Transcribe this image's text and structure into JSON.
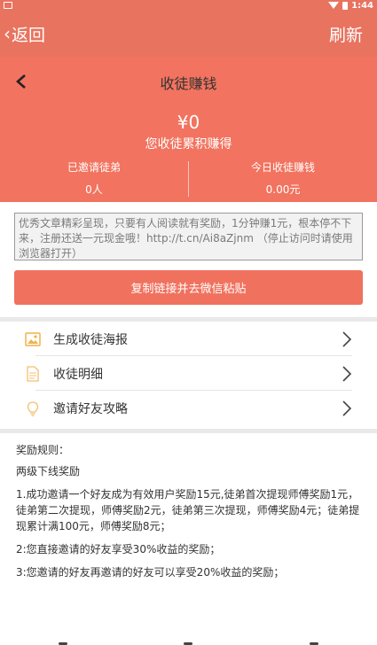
{
  "status_bar": {
    "time": "1:44"
  },
  "app_bar": {
    "back_label": "返回",
    "refresh_label": "刷新"
  },
  "hero": {
    "title": "收徒赚钱",
    "amount": "¥0",
    "amount_caption": "您收徒累积赚得",
    "stats": [
      {
        "label": "已邀请徒弟",
        "value": "0人"
      },
      {
        "label": "今日收徒赚钱",
        "value": "0.00元"
      }
    ]
  },
  "share": {
    "text": "优秀文章精彩呈现，只要有人阅读就有奖励，1分钟赚1元，根本停不下来，注册还送一元现金哦！http://t.cn/Ai8aZjnm （停止访问时请使用浏览器打开）",
    "copy_button": "复制链接并去微信粘贴"
  },
  "menu": [
    {
      "label": "生成收徒海报",
      "icon": "image-icon"
    },
    {
      "label": "收徒明细",
      "icon": "document-icon"
    },
    {
      "label": "邀请好友攻略",
      "icon": "lightbulb-icon"
    }
  ],
  "rules": {
    "title": "奖励规则：",
    "subtitle": "两级下线奖励",
    "items": [
      "1.成功邀请一个好友成为有效用户奖励15元,徒弟首次提现师傅奖励1元，徒弟第二次提现，师傅奖励2元，徒弟第三次提现，师傅奖励4元；徒弟提现累计满100元，师傅奖励8元；",
      "2:您直接邀请的好友享受30%收益的奖励；",
      "3:您邀请的好友再邀请的好友可以享受20%收益的奖励；"
    ]
  },
  "colors": {
    "primary": "#e8735f",
    "hero": "#f2735f",
    "button": "#f0725e",
    "icon_accent": "#f0b24a"
  }
}
